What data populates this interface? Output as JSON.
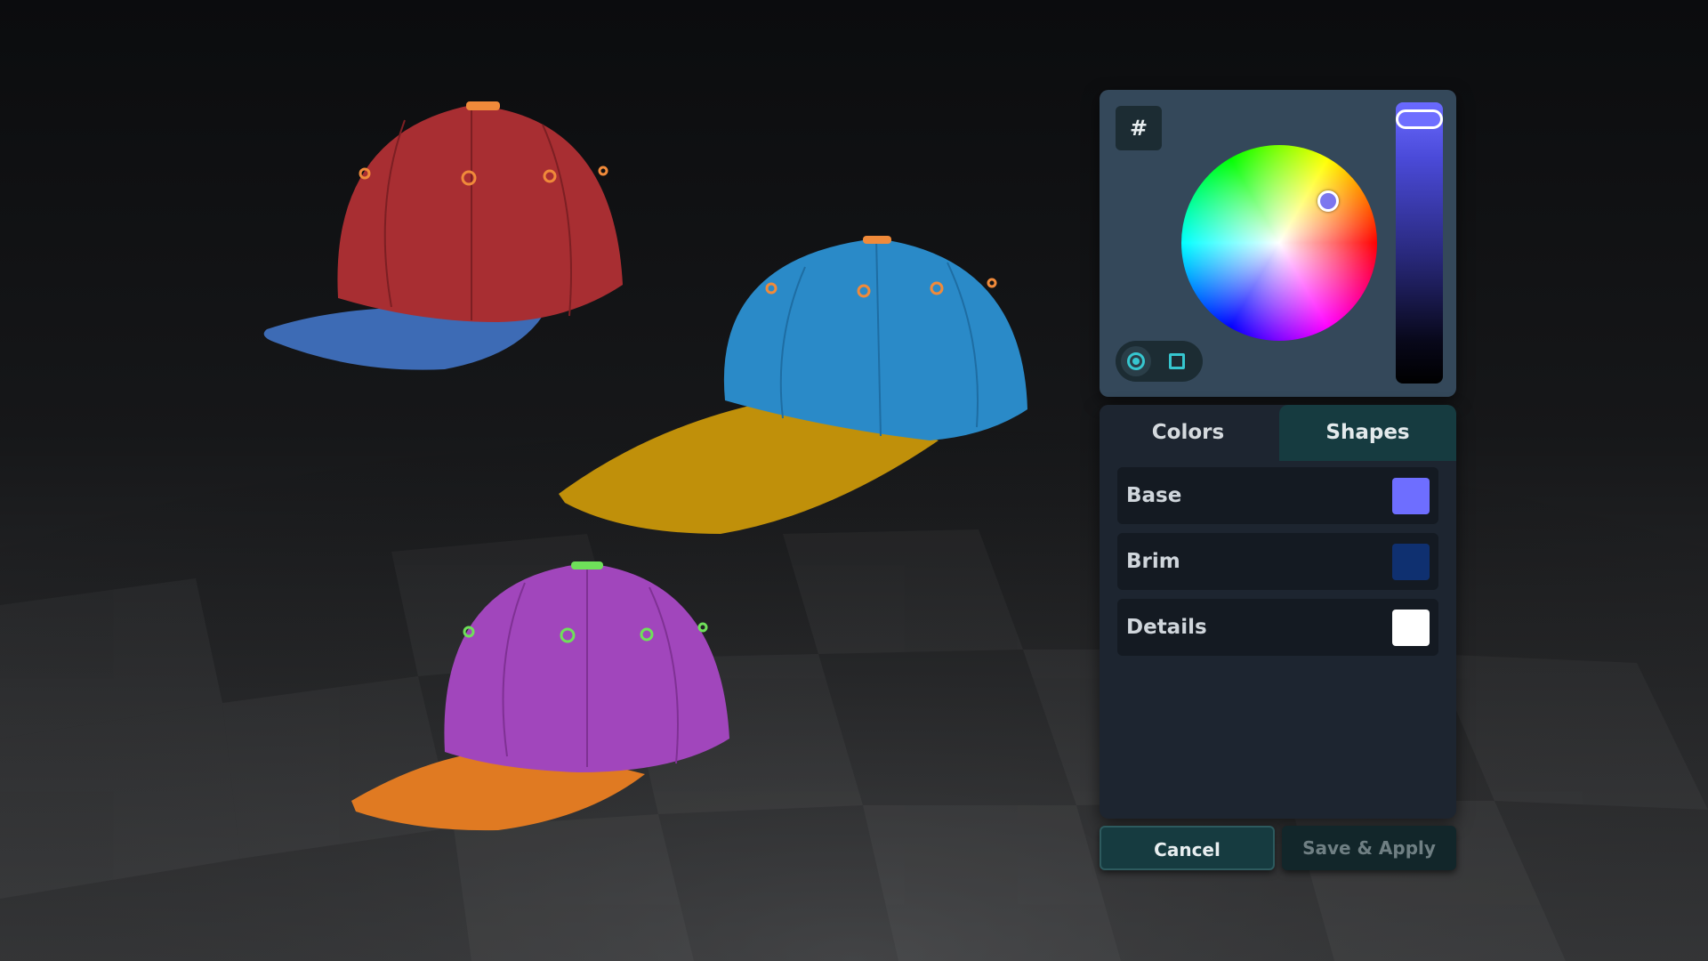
{
  "colors": {
    "accent": "#36c6cf",
    "selected": "#6e6eff",
    "caps": {
      "red_crown": "#a82e32",
      "blue_brim": "#3d6bb5",
      "blue_crown": "#2a8ac8",
      "yellow_brim": "#c0900a",
      "purple_crown": "#a146bc",
      "orange_brim": "#e07a22",
      "orange_eyelet": "#f08a3a",
      "green_eyelet": "#6fe05a"
    }
  },
  "picker": {
    "hex_label": "#",
    "hue_handle_icon": "circle-handle-icon",
    "modes": [
      "circle-mode-icon",
      "square-mode-icon"
    ],
    "brightness": 1.0
  },
  "tabs": [
    {
      "label": "Colors",
      "active": true
    },
    {
      "label": "Shapes",
      "active": false
    }
  ],
  "parts": [
    {
      "label": "Base",
      "color": "#6e6eff"
    },
    {
      "label": "Brim",
      "color": "#0f3070"
    },
    {
      "label": "Details",
      "color": "#ffffff"
    }
  ],
  "actions": {
    "cancel_label": "Cancel",
    "save_label": "Save & Apply"
  }
}
